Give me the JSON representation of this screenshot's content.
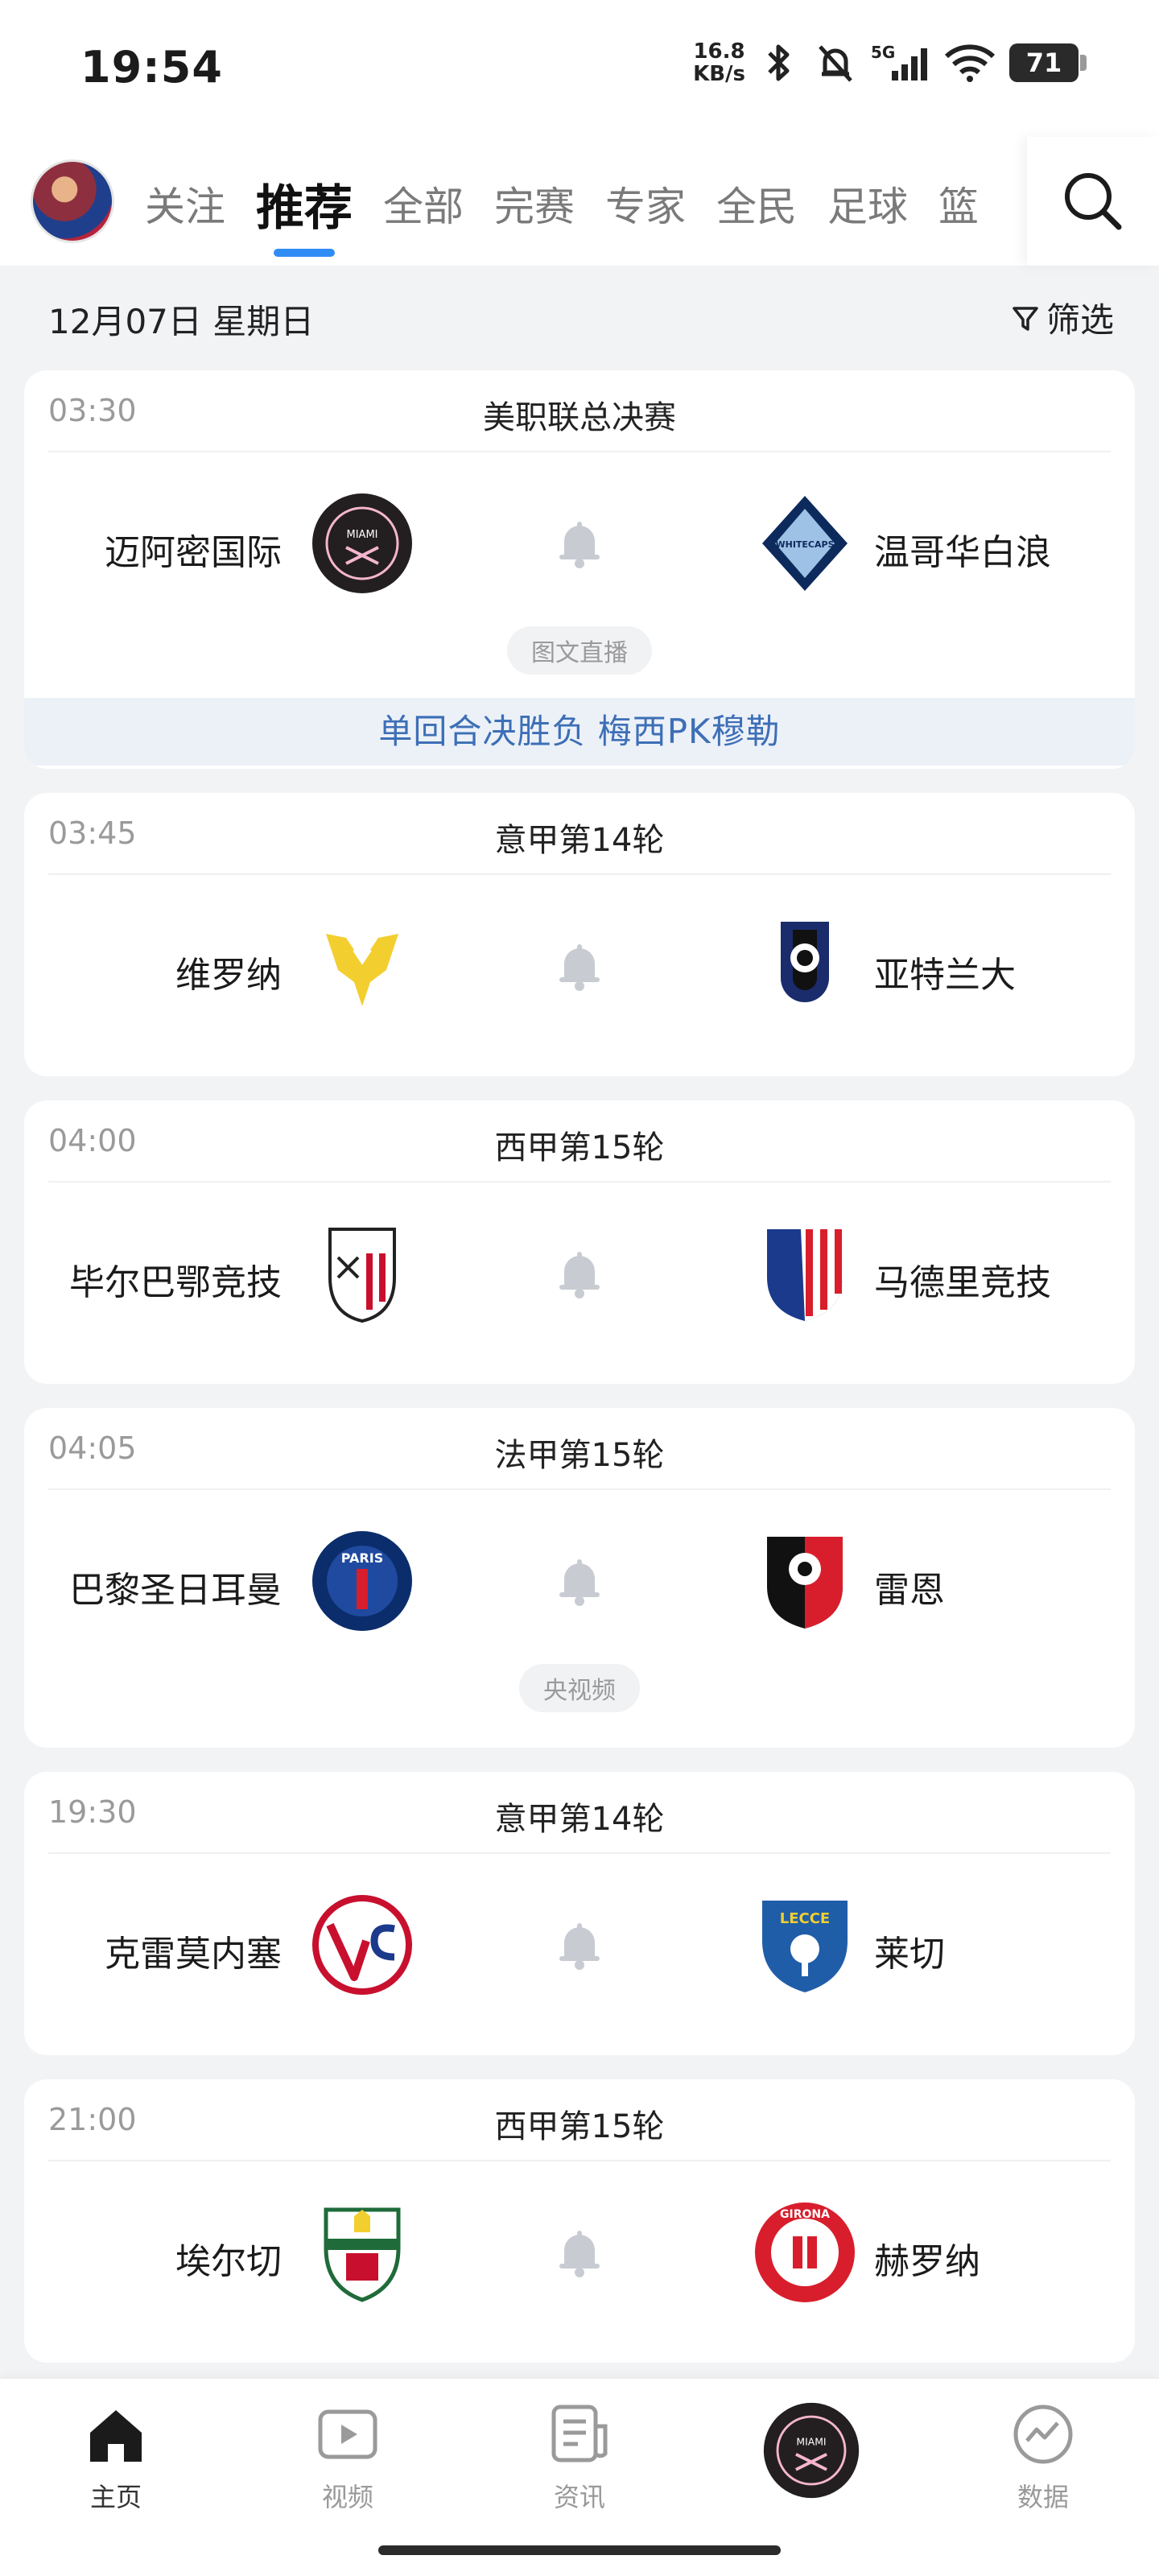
{
  "status_bar": {
    "time": "19:54",
    "net_speed_value": "16.8",
    "net_speed_unit": "KB/s",
    "network": "5G",
    "battery": "71"
  },
  "top_nav": {
    "tabs": [
      "关注",
      "推荐",
      "全部",
      "完赛",
      "专家",
      "全民",
      "足球",
      "篮"
    ],
    "active_tab": "推荐"
  },
  "date_bar": {
    "date": "12月07日 星期日",
    "filter_label": "筛选"
  },
  "matches": [
    {
      "time": "03:30",
      "league": "美职联总决赛",
      "home": "迈阿密国际",
      "away": "温哥华白浪",
      "tag": "图文直播",
      "promo": "单回合决胜负 梅西PK穆勒"
    },
    {
      "time": "03:45",
      "league": "意甲第14轮",
      "home": "维罗纳",
      "away": "亚特兰大"
    },
    {
      "time": "04:00",
      "league": "西甲第15轮",
      "home": "毕尔巴鄂竞技",
      "away": "马德里竞技"
    },
    {
      "time": "04:05",
      "league": "法甲第15轮",
      "home": "巴黎圣日耳曼",
      "away": "雷恩",
      "tag": "央视频"
    },
    {
      "time": "19:30",
      "league": "意甲第14轮",
      "home": "克雷莫内塞",
      "away": "莱切"
    },
    {
      "time": "21:00",
      "league": "西甲第15轮",
      "home": "埃尔切",
      "away": "赫罗纳"
    }
  ],
  "crest_text": {
    "miami": "MIAMI",
    "whitecaps": "WHITECAPS",
    "paris": "PARIS",
    "lecce": "LECCE",
    "girona": "GIRONA"
  },
  "bottom_nav": {
    "items": [
      {
        "label": "主页",
        "icon": "home-icon"
      },
      {
        "label": "视频",
        "icon": "video-icon"
      },
      {
        "label": "资讯",
        "icon": "news-icon"
      },
      {
        "label": "",
        "icon": "inter-miami-badge-icon"
      },
      {
        "label": "数据",
        "icon": "data-chart-icon"
      }
    ],
    "active": "主页"
  },
  "colors": {
    "accent": "#2f8cf5",
    "promo_text": "#3d6fb6",
    "promo_bg": "#ecf1f8"
  }
}
